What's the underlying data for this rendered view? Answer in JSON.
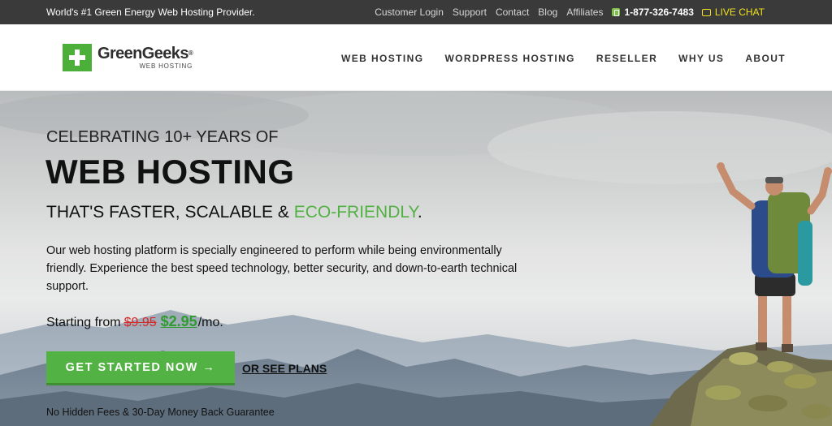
{
  "topbar": {
    "tagline": "World's #1 Green Energy Web Hosting Provider.",
    "links": [
      "Customer Login",
      "Support",
      "Contact",
      "Blog",
      "Affiliates"
    ],
    "phone": "1-877-326-7483",
    "live_chat": "LIVE CHAT"
  },
  "logo": {
    "name": "GreenGeeks",
    "registered": "®",
    "sub": "WEB HOSTING"
  },
  "nav": [
    "WEB HOSTING",
    "WORDPRESS HOSTING",
    "RESELLER",
    "WHY US",
    "ABOUT"
  ],
  "hero": {
    "celebrate": "CELEBRATING 10+ YEARS OF",
    "headline": "WEB HOSTING",
    "subhead_prefix": "THAT'S FASTER, SCALABLE & ",
    "subhead_eco": "ECO-FRIENDLY",
    "subhead_suffix": ".",
    "description": "Our web hosting platform is specially engineered to perform while being environmentally friendly. Experience the best speed technology, better security, and down-to-earth technical support.",
    "starting_from": "Starting from",
    "old_price": "$9.95",
    "new_price": "$2.95",
    "per_month": "/mo.",
    "cta_label": "GET STARTED NOW →",
    "see_plans": "OR SEE PLANS",
    "guarantee": "No Hidden Fees & 30-Day Money Back Guarantee"
  },
  "colors": {
    "brand_green": "#52b243",
    "topbar_bg": "#3a3a3a",
    "live_chat_yellow": "#f2e21b",
    "old_price_red": "#d52a2a",
    "new_price_green": "#2f9a2e"
  },
  "icons": {
    "phone": "phone-icon",
    "chat": "chat-icon"
  }
}
